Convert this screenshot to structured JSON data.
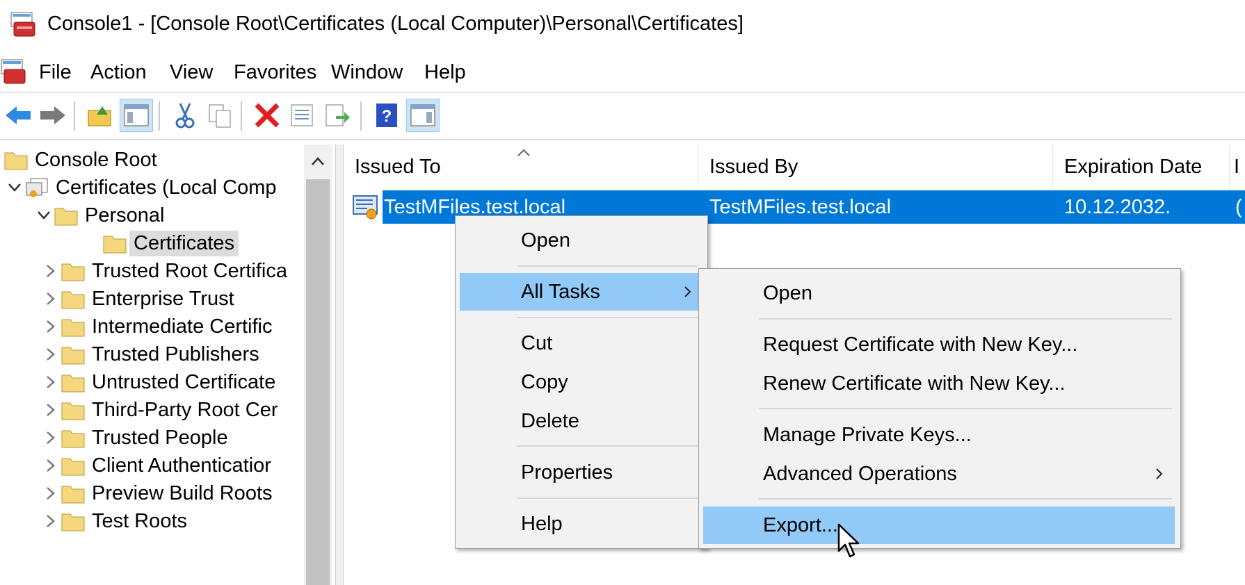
{
  "window": {
    "title": "Console1 - [Console Root\\Certificates (Local Computer)\\Personal\\Certificates]"
  },
  "menu": [
    "File",
    "Action",
    "View",
    "Favorites",
    "Window",
    "Help"
  ],
  "toolbar": {
    "buttons": [
      "back-icon",
      "forward-icon",
      "up-folder-icon",
      "show-hide-tree-icon",
      "cut-icon",
      "copy-icon",
      "delete-icon",
      "properties-icon",
      "export-list-icon",
      "help-icon",
      "show-action-pane-icon"
    ]
  },
  "tree": {
    "items": [
      {
        "label": "Console Root"
      },
      {
        "label": "Certificates (Local Comp"
      },
      {
        "label": "Personal"
      },
      {
        "label": "Certificates"
      },
      {
        "label": "Trusted Root Certifica"
      },
      {
        "label": "Enterprise Trust"
      },
      {
        "label": "Intermediate Certific"
      },
      {
        "label": "Trusted Publishers"
      },
      {
        "label": "Untrusted Certificate"
      },
      {
        "label": "Third-Party Root Cer"
      },
      {
        "label": "Trusted People"
      },
      {
        "label": "Client Authenticatior"
      },
      {
        "label": "Preview Build Roots"
      },
      {
        "label": "Test Roots"
      }
    ]
  },
  "list": {
    "columns": [
      "Issued To",
      "Issued By",
      "Expiration Date",
      "I"
    ],
    "rows": [
      {
        "issued_to": "TestMFiles.test.local",
        "issued_by": "TestMFiles.test.local",
        "expiration": "10.12.2032.",
        "more": "("
      }
    ]
  },
  "context_menu": {
    "items": [
      "Open",
      "All Tasks",
      "Cut",
      "Copy",
      "Delete",
      "Properties",
      "Help"
    ]
  },
  "submenu": {
    "items": [
      "Open",
      "Request Certificate with New Key...",
      "Renew Certificate with New Key...",
      "Manage Private Keys...",
      "Advanced Operations",
      "Export..."
    ]
  },
  "colors": {
    "selection": "#0078d7",
    "menu_highlight": "#91c9f7",
    "folder": "#f5d77e"
  }
}
